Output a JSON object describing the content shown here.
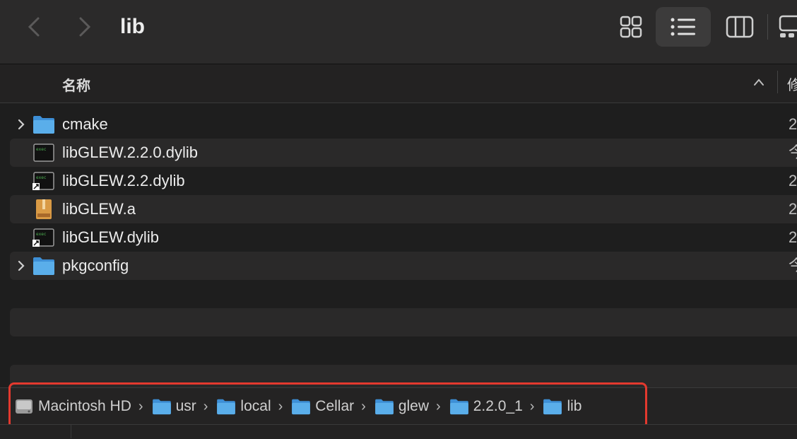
{
  "window": {
    "title": "lib"
  },
  "toolbar": {
    "back": "chevron-left-icon",
    "forward": "chevron-right-icon",
    "views": [
      {
        "name": "icon-view",
        "active": false
      },
      {
        "name": "list-view",
        "active": true
      },
      {
        "name": "column-view",
        "active": false
      },
      {
        "name": "gallery-view",
        "active": false
      }
    ]
  },
  "header": {
    "name_col": "名称",
    "date_col": "修"
  },
  "files": [
    {
      "name": "cmake",
      "kind": "folder",
      "date": "2"
    },
    {
      "name": "libGLEW.2.2.0.dylib",
      "kind": "exec",
      "date": "今"
    },
    {
      "name": "libGLEW.2.2.dylib",
      "kind": "alias",
      "date": "2"
    },
    {
      "name": "libGLEW.a",
      "kind": "archive",
      "date": "2"
    },
    {
      "name": "libGLEW.dylib",
      "kind": "alias",
      "date": "2"
    },
    {
      "name": "pkgconfig",
      "kind": "folder",
      "date": "今"
    }
  ],
  "pathbar": {
    "crumbs": [
      {
        "label": "Macintosh HD",
        "icon": "hard-drive-icon"
      },
      {
        "label": "usr",
        "icon": "folder-icon"
      },
      {
        "label": "local",
        "icon": "folder-icon"
      },
      {
        "label": "Cellar",
        "icon": "folder-icon"
      },
      {
        "label": "glew",
        "icon": "folder-icon"
      },
      {
        "label": "2.2.0_1",
        "icon": "folder-icon"
      },
      {
        "label": "lib",
        "icon": "folder-icon"
      }
    ],
    "separator": "›"
  },
  "colors": {
    "folder": "#4fa6e6",
    "highlight": "#e3392e"
  }
}
